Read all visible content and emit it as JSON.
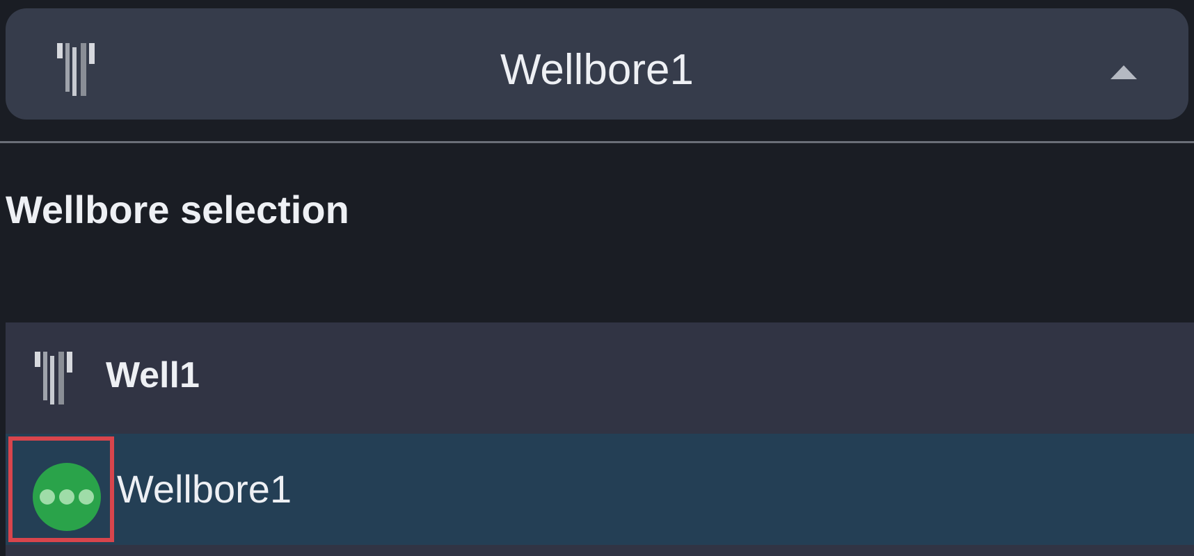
{
  "header": {
    "selected_wellbore": "Wellbore1",
    "leading_icon": "well-icon",
    "trailing_icon": "caret-up-icon",
    "expanded": true
  },
  "panel": {
    "title": "Wellbore selection"
  },
  "tree": {
    "well": {
      "label": "Well1",
      "icon": "well-icon"
    },
    "wellbores": [
      {
        "label": "Wellbore1",
        "status_icon": "status-in-progress-icon",
        "selected": true
      }
    ]
  },
  "colors": {
    "background": "#1a1d24",
    "selector_bar": "#363c4b",
    "list_background": "#313444",
    "selected_row": "#243f55",
    "status_green": "#2aa34a",
    "highlight_border": "#d8454c",
    "text": "#eef0f4"
  }
}
